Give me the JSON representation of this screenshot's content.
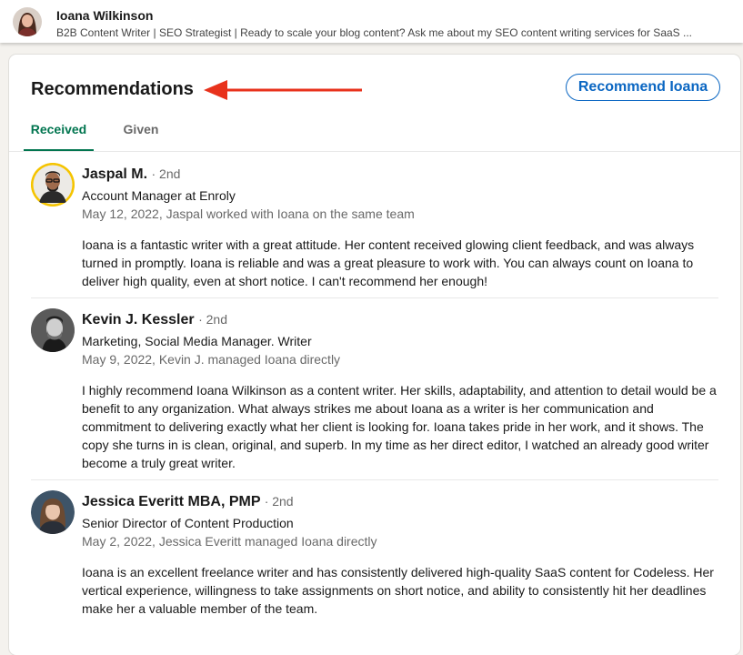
{
  "profile": {
    "name": "Ioana Wilkinson",
    "headline": "B2B Content Writer | SEO Strategist | Ready to scale your blog content? Ask me about my SEO content writing services for SaaS ..."
  },
  "section": {
    "title": "Recommendations",
    "recommend_button": "Recommend Ioana",
    "arrow_color": "#e8321c"
  },
  "tabs": [
    {
      "label": "Received",
      "active": true
    },
    {
      "label": "Given",
      "active": false
    }
  ],
  "colors": {
    "accent_green": "#01754f",
    "link_blue": "#0a66c2"
  },
  "recommendations": [
    {
      "name": "Jaspal M.",
      "degree": "· 2nd",
      "title": "Account Manager at Enroly",
      "meta": "May 12, 2022, Jaspal worked with Ioana on the same team",
      "text": "Ioana is a fantastic writer with a great attitude. Her content received glowing client feedback, and was always turned in promptly. Ioana is reliable and was a great pleasure to work with. You can always count on Ioana to deliver high quality, even at short notice. I can't recommend her enough!"
    },
    {
      "name": "Kevin J. Kessler",
      "degree": "· 2nd",
      "title": "Marketing, Social Media Manager. Writer",
      "meta": "May 9, 2022, Kevin J. managed Ioana directly",
      "text": "I highly recommend Ioana Wilkinson as a content writer. Her skills, adaptability, and attention to detail would be a benefit to any organization. What always strikes me about Ioana as a writer is her communication and commitment to delivering exactly what her client is looking for. Ioana takes pride in her work, and it shows. The copy she turns in is clean, original, and superb. In my time as her direct editor, I watched an already good writer become a truly great writer."
    },
    {
      "name": "Jessica Everitt MBA, PMP",
      "degree": "· 2nd",
      "title": "Senior Director of Content Production",
      "meta": "May 2, 2022, Jessica Everitt managed Ioana directly",
      "text": "Ioana is an excellent freelance writer and has consistently delivered high-quality SaaS content for Codeless. Her vertical experience, willingness to take assignments on short notice, and ability to consistently hit her deadlines make her a valuable member of the team."
    }
  ]
}
